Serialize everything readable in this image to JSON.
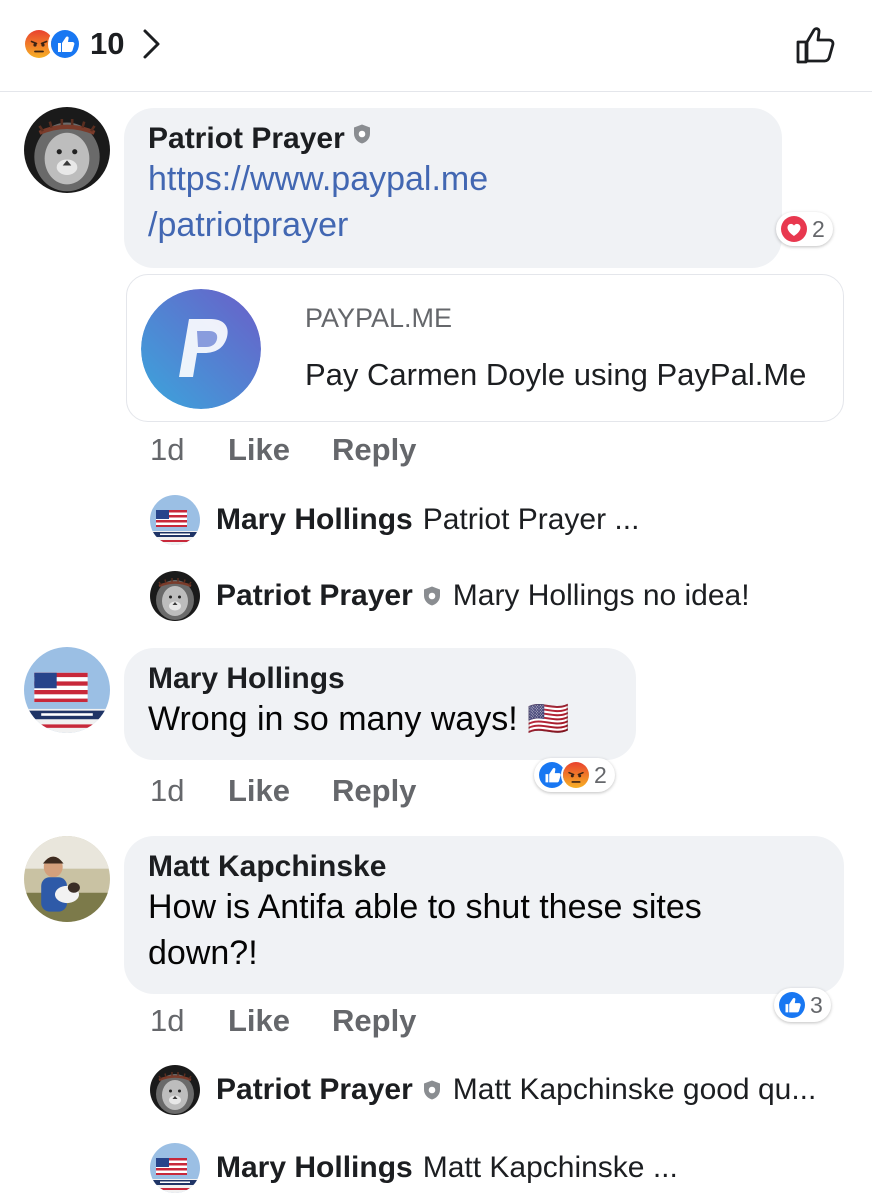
{
  "summary": {
    "reactions": [
      "angry-icon",
      "like-icon"
    ],
    "count": "10"
  },
  "colors": {
    "like_blue": "#1877f2",
    "angry_orange": "#f0812b",
    "love_red": "#e8384f",
    "link_blue": "#4267b2",
    "bubble_gray": "#f0f2f5",
    "meta_gray": "#65676b"
  },
  "comments": [
    {
      "author": "Patriot Prayer",
      "verified": true,
      "link_line1": "https://www.paypal.me",
      "link_line2": "/patriotprayer",
      "reaction_count": "2",
      "reactions": [
        "love-icon"
      ],
      "preview": {
        "domain": "PAYPAL.ME",
        "title": "Pay Carmen Doyle using PayPal.Me"
      },
      "time": "1d",
      "like": "Like",
      "reply": "Reply"
    },
    {
      "author": "Mary Hollings",
      "text": "Wrong in so many ways! 🇺🇸",
      "reaction_count": "2",
      "reactions": [
        "like-icon",
        "angry-icon"
      ],
      "time": "1d",
      "like": "Like",
      "reply": "Reply"
    },
    {
      "author": "Matt Kapchinske",
      "text_line1": "How is Antifa able to shut these sites",
      "text_line2": "down?!",
      "reaction_count": "3",
      "reactions": [
        "like-icon"
      ],
      "time": "1d",
      "like": "Like",
      "reply": "Reply"
    }
  ],
  "replies": [
    {
      "author": "Mary Hollings",
      "text": "Patriot Prayer ..."
    },
    {
      "author": "Patriot Prayer",
      "verified": true,
      "text": "Mary Hollings no idea!"
    },
    {
      "author": "Patriot Prayer",
      "verified": true,
      "text": "Matt Kapchinske good qu..."
    },
    {
      "author": "Mary Hollings",
      "text": "Matt Kapchinske ..."
    }
  ]
}
